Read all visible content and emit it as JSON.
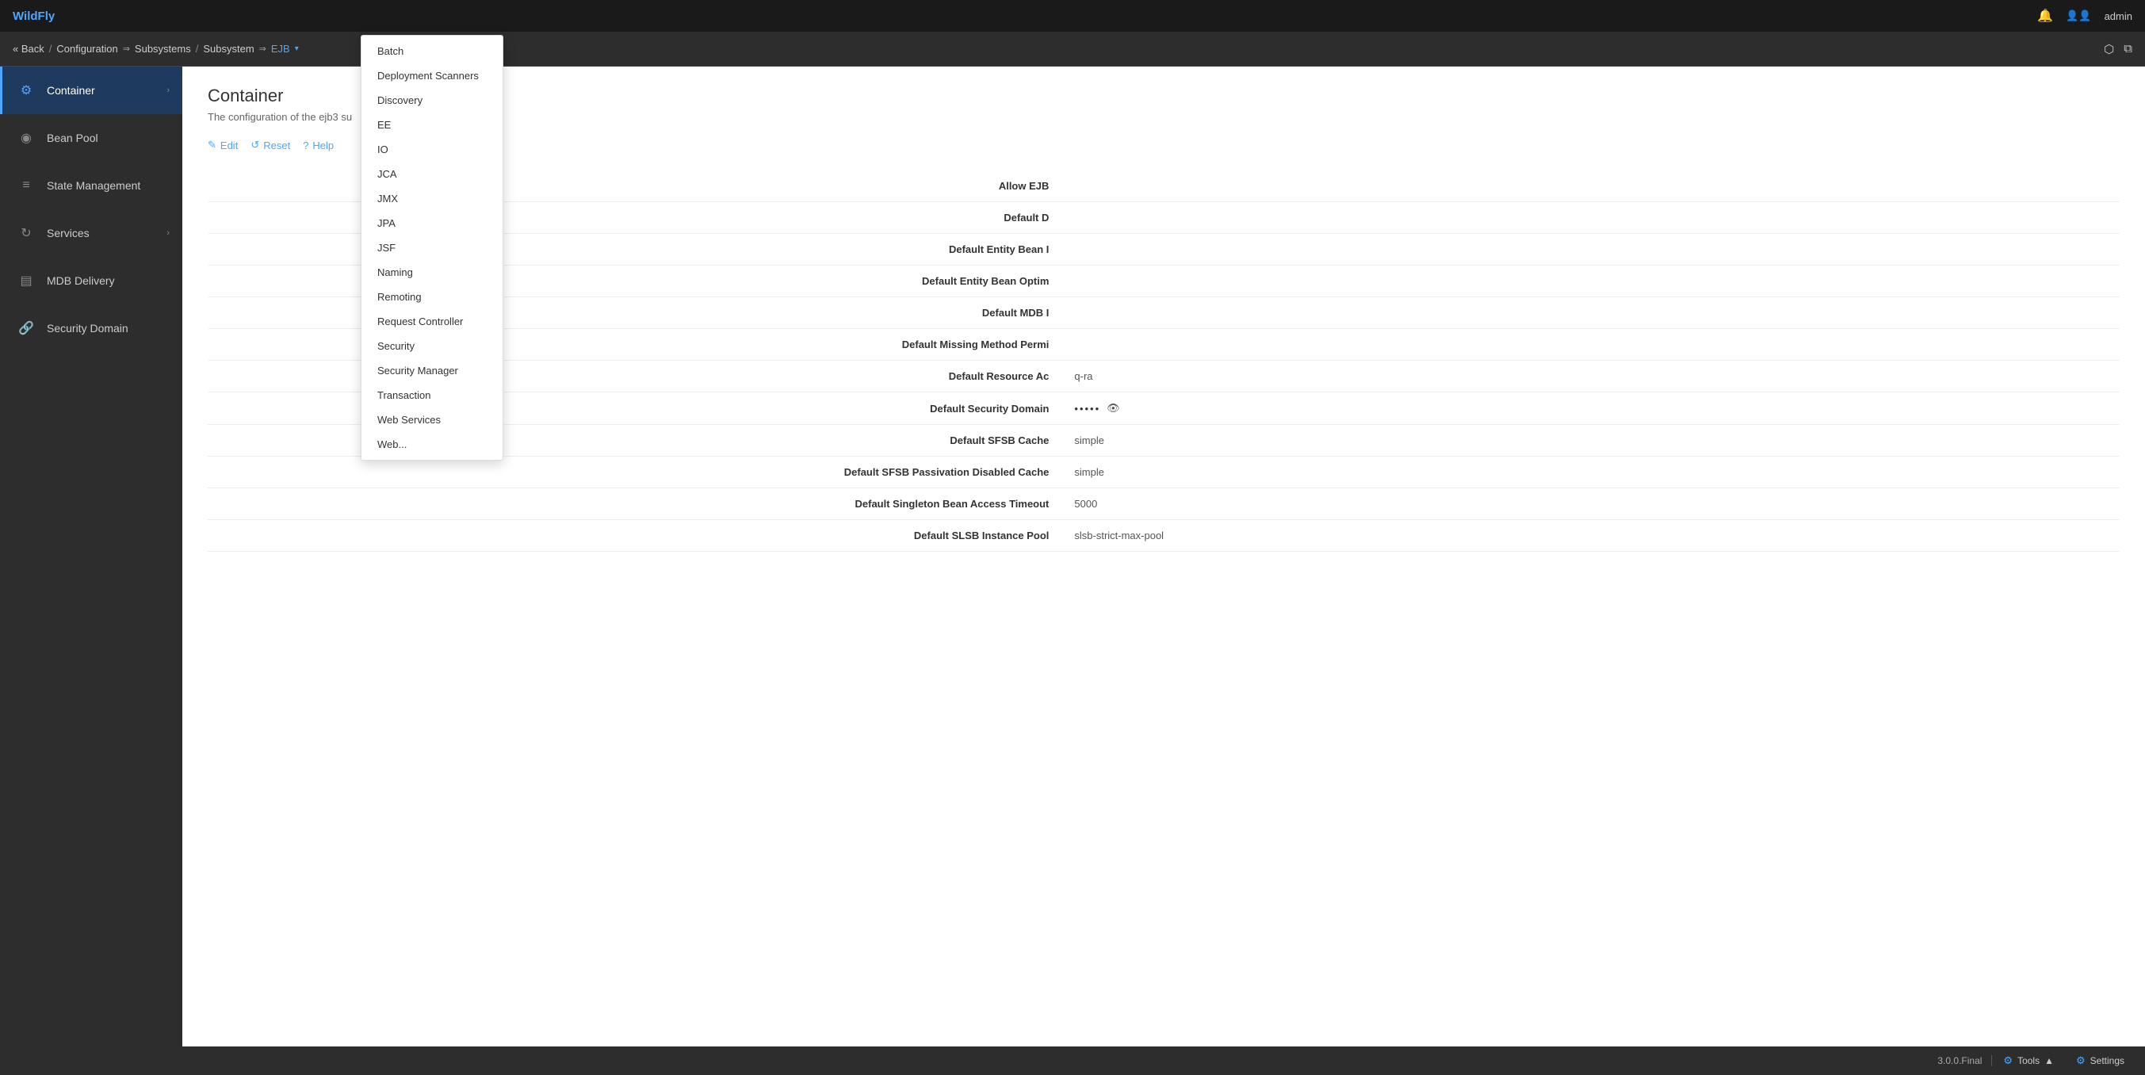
{
  "brand": {
    "name_start": "Wild",
    "name_end": "Fly"
  },
  "topbar": {
    "bell_label": "🔔",
    "admin_label": "admin"
  },
  "breadcrumb": {
    "back": "« Back",
    "config": "Configuration",
    "arrow1": "⇒",
    "subsystems": "Subsystems",
    "slash": "/",
    "subsystem": "Subsystem",
    "arrow2": "⇒",
    "ejb": "EJB",
    "dropdown_arrow": "▾"
  },
  "sidebar": {
    "items": [
      {
        "id": "container",
        "label": "Container",
        "icon": "⚙",
        "active": true,
        "has_chevron": true
      },
      {
        "id": "bean-pool",
        "label": "Bean Pool",
        "icon": "◉",
        "active": false,
        "has_chevron": false
      },
      {
        "id": "state-management",
        "label": "State Management",
        "icon": "≡",
        "active": false,
        "has_chevron": false
      },
      {
        "id": "services",
        "label": "Services",
        "icon": "↻",
        "active": false,
        "has_chevron": true
      },
      {
        "id": "mdb-delivery",
        "label": "MDB Delivery",
        "icon": "▤",
        "active": false,
        "has_chevron": false
      },
      {
        "id": "security-domain",
        "label": "Security Domain",
        "icon": "🔗",
        "active": false,
        "has_chevron": false
      }
    ]
  },
  "page": {
    "title": "Container",
    "description": "The configuration of the ejb3 su",
    "toolbar": {
      "edit": "Edit",
      "reset": "Reset",
      "help": "Help"
    }
  },
  "form_fields": [
    {
      "label": "Allow EJB",
      "value": ""
    },
    {
      "label": "Default D",
      "value": ""
    },
    {
      "label": "Default Entity Bean I",
      "value": ""
    },
    {
      "label": "Default Entity Bean Optim",
      "value": ""
    },
    {
      "label": "Default MDB I",
      "value": ""
    },
    {
      "label": "Default Missing Method Permi",
      "value": ""
    },
    {
      "label": "Default Resource Ac",
      "value": "q-ra"
    },
    {
      "label": "Default Security Domain",
      "value": "•••••",
      "masked": true
    },
    {
      "label": "Default SFSB Cache",
      "value": "simple"
    },
    {
      "label": "Default SFSB Passivation Disabled Cache",
      "value": "simple"
    },
    {
      "label": "Default Singleton Bean Access Timeout",
      "value": "5000"
    },
    {
      "label": "Default SLSB Instance Pool",
      "value": "slsb-strict-max-pool"
    }
  ],
  "dropdown": {
    "items": [
      "Batch",
      "Deployment Scanners",
      "Discovery",
      "EE",
      "IO",
      "JCA",
      "JMX",
      "JPA",
      "JSF",
      "Naming",
      "Remoting",
      "Request Controller",
      "Security",
      "Security Manager",
      "Transaction",
      "Web Services",
      "Web..."
    ]
  },
  "footer": {
    "version": "3.0.0.Final",
    "tools": "Tools",
    "settings": "Settings"
  }
}
